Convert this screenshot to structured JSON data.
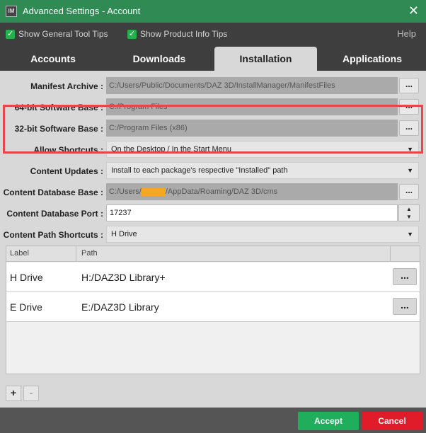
{
  "window": {
    "title": "Advanced Settings - Account",
    "app_icon_text": "IM"
  },
  "topbar": {
    "general_tips": "Show General Tool Tips",
    "product_tips": "Show Product Info Tips",
    "help": "Help"
  },
  "tabs": [
    {
      "label": "Accounts"
    },
    {
      "label": "Downloads"
    },
    {
      "label": "Installation"
    },
    {
      "label": "Applications"
    }
  ],
  "settings": {
    "manifest_archive": {
      "label": "Manifest Archive :",
      "value": "C:/Users/Public/Documents/DAZ 3D/InstallManager/ManifestFiles"
    },
    "sw64": {
      "label": "64-bit Software Base :",
      "value": "C:/Program Files"
    },
    "sw32": {
      "label": "32-bit Software Base :",
      "value": "C:/Program Files (x86)"
    },
    "shortcuts": {
      "label": "Allow Shortcuts :",
      "value": "On the Desktop / In the Start Menu"
    },
    "content_updates": {
      "label": "Content Updates :",
      "value": "Install to each package's respective \"Installed\" path"
    },
    "cms_base": {
      "label": "Content Database Base :",
      "value_prefix": "C:/Users/",
      "value_suffix": "/AppData/Roaming/DAZ 3D/cms"
    },
    "cms_port": {
      "label": "Content Database Port :",
      "value": "17237"
    },
    "path_shortcuts": {
      "label": "Content Path Shortcuts :",
      "value": "H Drive"
    }
  },
  "browse_label": "...",
  "table": {
    "headers": [
      "Label",
      "Path"
    ],
    "rows": [
      {
        "label": "H Drive",
        "path": "H:/DAZ3D Library+"
      },
      {
        "label": "E Drive",
        "path": "E:/DAZ3D Library"
      }
    ]
  },
  "list_buttons": {
    "add": "+",
    "remove": "-"
  },
  "footer": {
    "accept": "Accept",
    "cancel": "Cancel"
  },
  "colors": {
    "accent": "#2f8a53",
    "accept": "#1fae5b",
    "cancel": "#e01b2a",
    "highlight": "#e8464b",
    "redaction": "#f5a623"
  }
}
